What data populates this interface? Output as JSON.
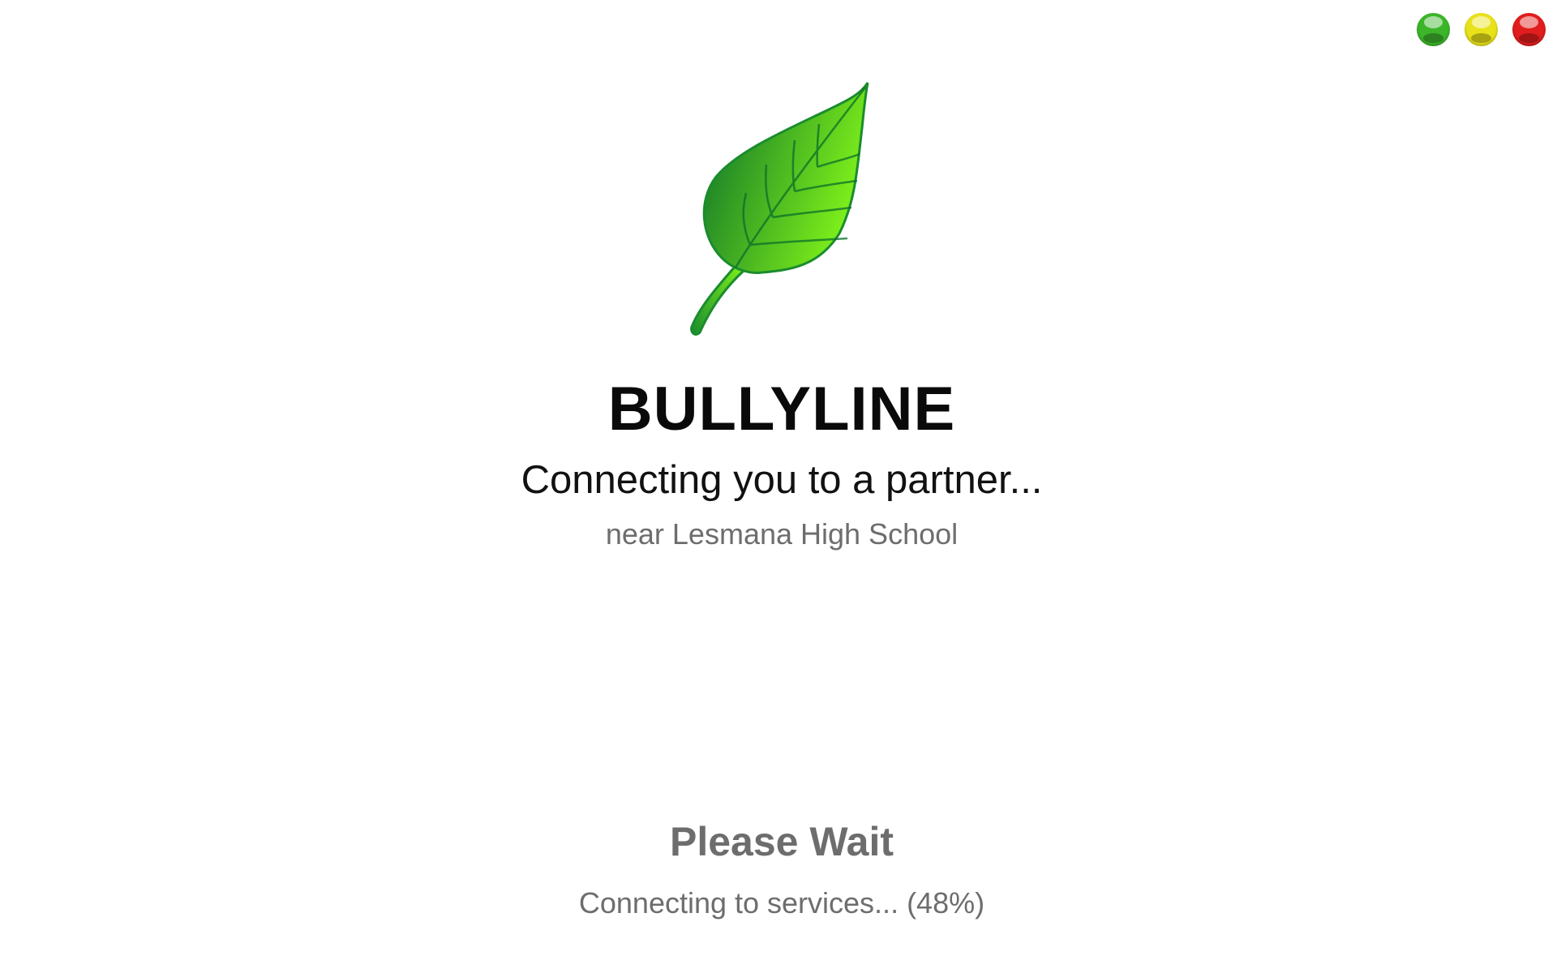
{
  "window_controls": {
    "colors": {
      "maximize": "#3cb52a",
      "minimize": "#e8e21a",
      "close": "#e21d1d"
    }
  },
  "logo": {
    "icon": "leaf-icon",
    "colors": {
      "dark": "#0a6e2a",
      "light": "#7ef01a",
      "outline": "#1a8c2e"
    }
  },
  "app": {
    "title": "BULLYLINE"
  },
  "status": {
    "heading": "Connecting you to a partner...",
    "location": "near Lesmana High School"
  },
  "loading": {
    "title": "Please Wait",
    "progress_text": "Connecting to services... (48%)",
    "progress_percent": 48
  }
}
